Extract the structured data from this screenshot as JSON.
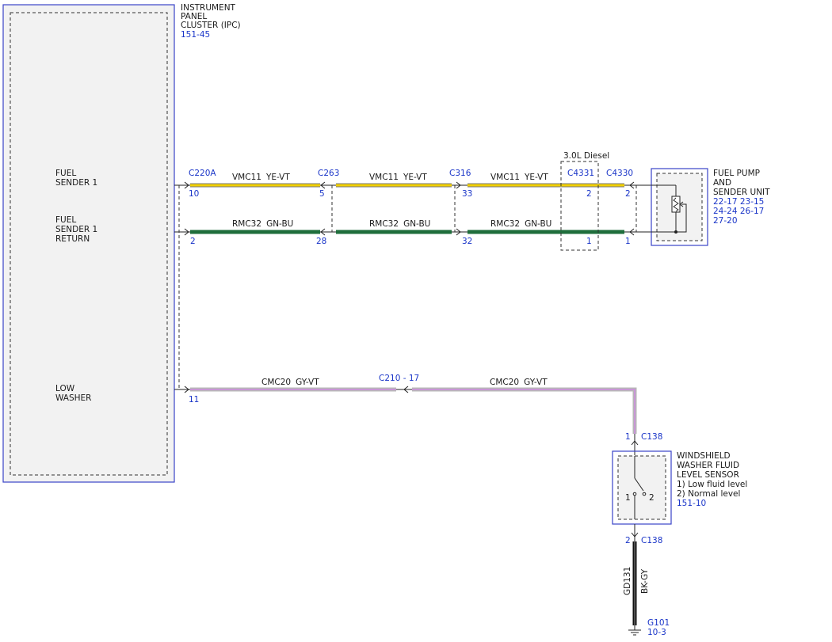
{
  "ipc": {
    "name_lines": [
      "INSTRUMENT",
      "PANEL",
      "CLUSTER (IPC)"
    ],
    "ref": "151-45",
    "pin_labels": {
      "fuel_sender": [
        "FUEL",
        "SENDER 1"
      ],
      "fuel_return": [
        "FUEL",
        "SENDER 1",
        "RETURN"
      ],
      "low_washer": [
        "LOW",
        "WASHER"
      ]
    }
  },
  "connectors": {
    "c220a": "C220A",
    "c263": "C263",
    "c316": "C316",
    "c4331": "C4331",
    "c4330": "C4330",
    "c210": "C210",
    "c210_pin": "17",
    "c138_top": "C138",
    "c138_bottom": "C138"
  },
  "pins": {
    "c220a_sender": "10",
    "c220a_return": "2",
    "c220a_washer": "11",
    "c263_sender": "5",
    "c263_return": "28",
    "c316_sender": "33",
    "c316_return": "32",
    "c4331_sender": "2",
    "c4331_return": "1",
    "c4330_sender": "2",
    "c4330_return": "1",
    "c138_top": "1",
    "c138_bottom": "2"
  },
  "wires": {
    "sender": {
      "circuit": "VMC11",
      "color": "YE-VT"
    },
    "return": {
      "circuit": "RMC32",
      "color": "GN-BU"
    },
    "washer": {
      "circuit": "CMC20",
      "color": "GY-VT"
    },
    "ground": {
      "circuit": "GD131",
      "color": "BK-GY"
    }
  },
  "diesel_label": "3.0L Diesel",
  "fuel_pump": {
    "name_lines": [
      "FUEL PUMP",
      "AND",
      "SENDER UNIT"
    ],
    "refs": [
      "22-17 23-15",
      "24-24 26-17",
      "27-20"
    ]
  },
  "washer_sensor": {
    "name_lines": [
      "WINDSHIELD",
      "WASHER FLUID",
      "LEVEL SENSOR",
      "1) Low fluid level",
      "2) Normal level"
    ],
    "ref": "151-10",
    "switch_pos1": "1",
    "switch_pos2": "2"
  },
  "ground": {
    "name": "G101",
    "ref": "10-3"
  },
  "colors": {
    "blue_ref": "#1a35c8",
    "wire_yellow": "#f2d000",
    "wire_green": "#1f6e3c",
    "wire_gray": "#b7b7b7",
    "wire_violet": "#c996d6",
    "wire_black": "#111111",
    "component_fill": "#f2f2f2"
  }
}
